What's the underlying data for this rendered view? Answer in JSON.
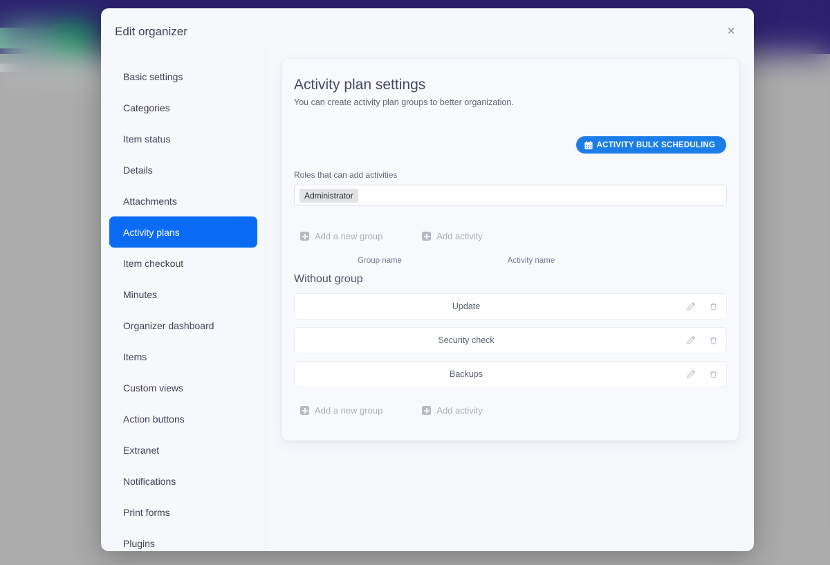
{
  "backdrop": {
    "note": "blurred page behind modal"
  },
  "modal": {
    "title": "Edit organizer",
    "close_label": "×"
  },
  "sidebar": {
    "items": [
      {
        "label": "Basic settings",
        "active": false
      },
      {
        "label": "Categories",
        "active": false
      },
      {
        "label": "Item status",
        "active": false
      },
      {
        "label": "Details",
        "active": false
      },
      {
        "label": "Attachments",
        "active": false
      },
      {
        "label": "Activity plans",
        "active": true
      },
      {
        "label": "Item checkout",
        "active": false
      },
      {
        "label": "Minutes",
        "active": false
      },
      {
        "label": "Organizer dashboard",
        "active": false
      },
      {
        "label": "Items",
        "active": false
      },
      {
        "label": "Custom views",
        "active": false
      },
      {
        "label": "Action buttons",
        "active": false
      },
      {
        "label": "Extranet",
        "active": false
      },
      {
        "label": "Notifications",
        "active": false
      },
      {
        "label": "Print forms",
        "active": false
      },
      {
        "label": "Plugins",
        "active": false
      }
    ]
  },
  "panel": {
    "title": "Activity plan settings",
    "subtitle": "You can create activity plan groups to better organization.",
    "bulk_button": "ACTIVITY BULK SCHEDULING",
    "bulk_button_icon": "calendar-icon",
    "roles_label": "Roles that can add activities",
    "roles_chips": [
      "Administrator"
    ],
    "add_group_label": "Add a new group",
    "add_activity_label": "Add activity",
    "columns": {
      "group_name": "Group name",
      "activity_name": "Activity name"
    },
    "group_title": "Without group",
    "activities": [
      {
        "name": "Update",
        "edit_icon": "pencil-icon",
        "delete_icon": "trash-icon"
      },
      {
        "name": "Security check",
        "edit_icon": "pencil-icon",
        "delete_icon": "trash-icon"
      },
      {
        "name": "Backups",
        "edit_icon": "pencil-icon",
        "delete_icon": "trash-icon"
      }
    ]
  },
  "colors": {
    "accent_blue": "#0a6cf5",
    "button_blue": "#1b7de8",
    "modal_bg": "#f7f8fc",
    "backdrop_purple": "#2d2070",
    "backdrop_green": "#1aa05e"
  }
}
